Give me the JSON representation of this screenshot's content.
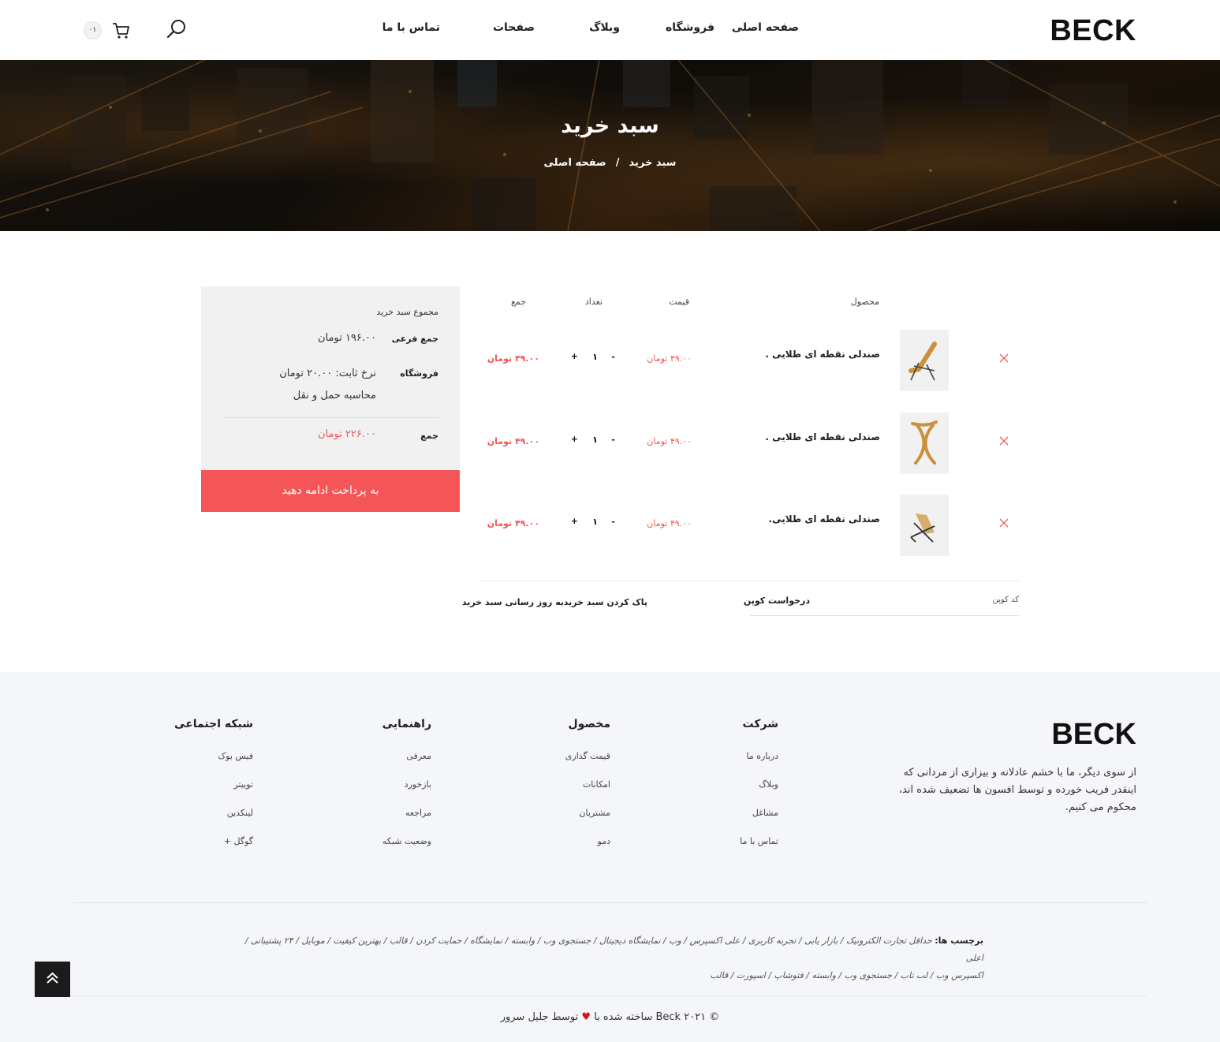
{
  "header": {
    "logo": "BECK",
    "nav": [
      "صفحه اصلی",
      "فروشگاه",
      "وبلاگ",
      "صفحات",
      "تماس با ما"
    ],
    "cart_count": "۰۱",
    "icons": {
      "search": "search-icon",
      "cart": "cart-icon"
    }
  },
  "hero": {
    "title": "سبد خرید",
    "breadcrumb_home": "صفحه اصلی",
    "breadcrumb_sep": "/",
    "breadcrumb_current": "سبد خرید"
  },
  "cart": {
    "headers": {
      "product": "محصول",
      "price": "قیمت",
      "quantity": "تعداد",
      "total": "جمع"
    },
    "items": [
      {
        "name": "صندلی نقطه ای طلایی .",
        "price": "۴۹.۰۰ تومان",
        "quantity": "۱",
        "total": "۴۹.۰۰ تومان"
      },
      {
        "name": "صندلی نقطه ای طلایی .",
        "price": "۴۹.۰۰ تومان",
        "quantity": "۱",
        "total": "۴۹.۰۰ تومان"
      },
      {
        "name": "صندلی نقطه ای طلایی.",
        "price": "۴۹.۰۰ تومان",
        "quantity": "۱",
        "total": "۴۹.۰۰ تومان"
      }
    ],
    "minus": "-",
    "plus": "+",
    "coupon_placeholder": "کد کوپن",
    "coupon_apply": "درخواست کوپن",
    "clear_cart": "پاک کردن سبد خرید",
    "update_cart": "به روز رسانی سبد خرید"
  },
  "totals": {
    "title": "مجموع سبد خرید",
    "subtotal_label": "جمع فرعی",
    "subtotal": "۱۹۶.۰۰ تومان",
    "shipping_label": "فروشگاه",
    "shipping_rate": "نرخ ثابت: ۲۰.۰۰ تومان",
    "shipping_calc": "محاسبه حمل و نقل",
    "total_label": "جمع",
    "total": "۲۲۶.۰۰ تومان",
    "checkout": "به پرداخت ادامه دهید"
  },
  "footer": {
    "logo": "BECK",
    "about": "از سوی دیگر، ما با خشم عادلانه و بیزاری از مردانی که اینقدر فریب خورده و توسط افسون ها تضعیف شده اند، محکوم می کنیم.",
    "columns": [
      {
        "title": "شرکت",
        "links": [
          "درباره ما",
          "وبلاگ",
          "مشاغل",
          "تماس با ما"
        ]
      },
      {
        "title": "مخصول",
        "links": [
          "قیمت گذاری",
          "امکانات",
          "مشتریان",
          "دمو"
        ]
      },
      {
        "title": "راهنمایی",
        "links": [
          "معرفی",
          "بازخورد",
          "مراجعه",
          "وضعیت شبکه"
        ]
      },
      {
        "title": "شبکه اجتماعی",
        "links": [
          "فیس بوک",
          "توییتر",
          "لینکدین",
          "گوگل +"
        ]
      }
    ],
    "tags_label": "برچسب ها:",
    "tags_line1": "حداقل تجارت الکترونیک / بازار یابی / تجربه کاربری / علی اکسپرس / وب / نمایشگاه دیجیتال / جستجوی وب / وابسته / نمایشگاه / حمایت کردن / قالب / بهترین کیفیت / موبایل / ۲۴ پشتیبانی /اعلی",
    "tags_line2": "اکسپرس  وب / لب تاب / جستجوی وب / وابسته / فتوشاپ / اسپورت / قالب",
    "copyright_pre": "© ۲۰۲۱ Beck ساخته شده با",
    "copyright_post": "توسط جلیل سرور",
    "heart": "♥"
  },
  "colors": {
    "accent": "#f45557",
    "dark": "#1b1b1b",
    "footer_bg": "#f4f6f9"
  }
}
